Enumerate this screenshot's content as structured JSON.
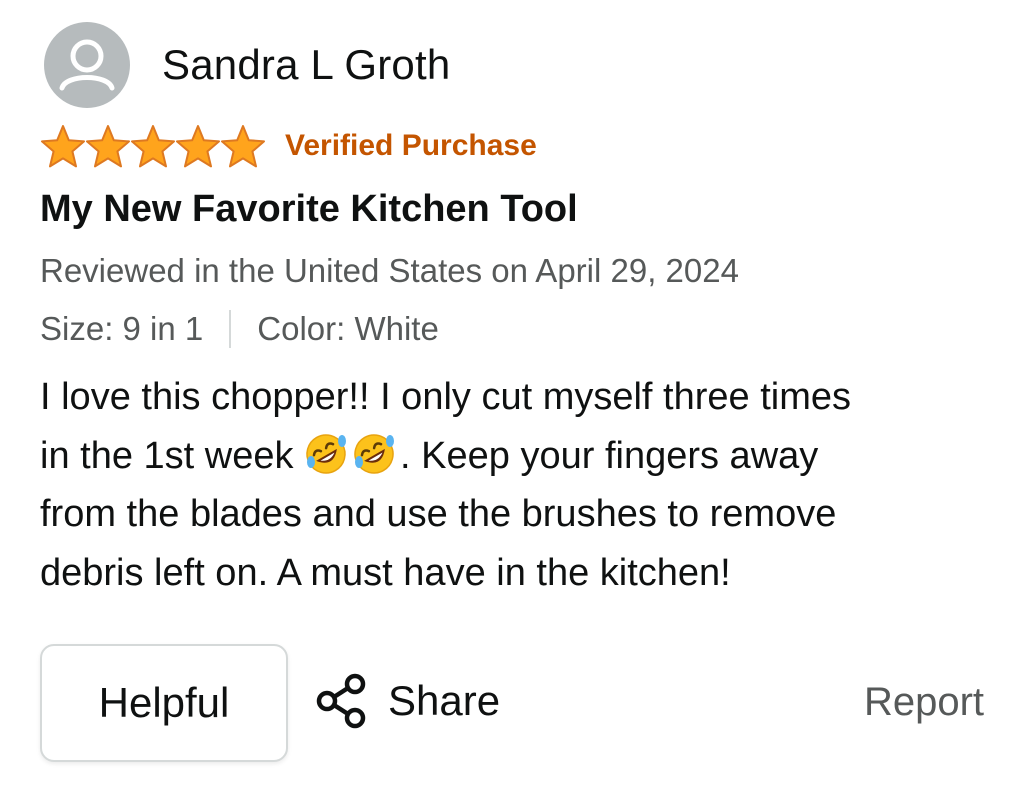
{
  "reviewer": {
    "name": "Sandra L Groth",
    "avatar_icon": "default-user-icon"
  },
  "rating": {
    "stars": 5,
    "max": 5,
    "star_color": "#ffa41c",
    "star_outline": "#de7921"
  },
  "badge": {
    "label": "Verified Purchase",
    "color": "#c45500"
  },
  "review": {
    "title": "My New Favorite Kitchen Tool",
    "date_line": "Reviewed in the United States on April 29, 2024",
    "size": "Size: 9 in 1",
    "color": "Color: White",
    "body_lines": [
      "I love this chopper!! I only cut myself three times",
      "in the 1st week",
      ". Keep your fingers away",
      "from the blades and use the brushes to remove",
      "debris left on. A must have in the kitchen!"
    ],
    "emoji_icon": "rolling-on-floor-laughing-emoji"
  },
  "actions": {
    "helpful_label": "Helpful",
    "share_label": "Share",
    "share_icon": "share-icon",
    "report_label": "Report"
  }
}
